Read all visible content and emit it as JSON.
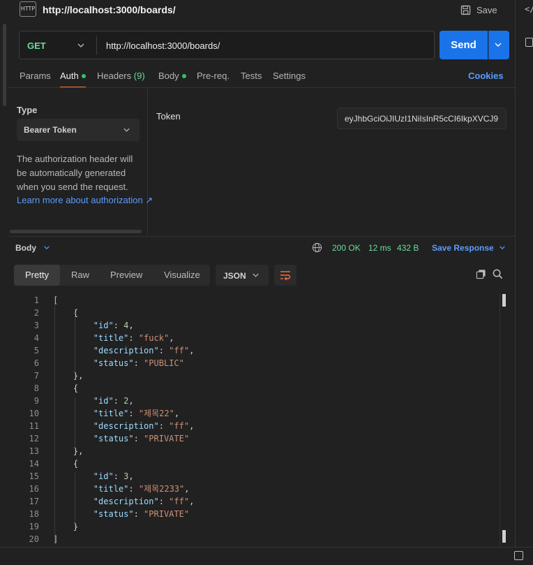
{
  "request": {
    "title": "http://localhost:3000/boards/",
    "save_label": "Save",
    "method": "GET",
    "url": "http://localhost:3000/boards/",
    "send_label": "Send"
  },
  "tabs": {
    "params": "Params",
    "auth": "Auth",
    "headers": "Headers",
    "headers_count": "(9)",
    "body": "Body",
    "prereq": "Pre-req.",
    "tests": "Tests",
    "settings": "Settings",
    "cookies": "Cookies"
  },
  "auth": {
    "type_label": "Type",
    "type_value": "Bearer Token",
    "description": "The authorization header will be automatically generated when you send the request.",
    "learn_more": "Learn more about authorization ↗",
    "token_label": "Token",
    "token_value": "eyJhbGciOiJIUzI1NiIsInR5cCI6IkpXVCJ9"
  },
  "response": {
    "body_label": "Body",
    "status": "200 OK",
    "time": "12 ms",
    "size": "432 B",
    "save_response": "Save Response",
    "view_tabs": [
      "Pretty",
      "Raw",
      "Preview",
      "Visualize"
    ],
    "format": "JSON",
    "lines": [
      [
        [
          "punc",
          "["
        ]
      ],
      [
        [
          "punc",
          "    {"
        ]
      ],
      [
        [
          "punc",
          "        "
        ],
        [
          "key",
          "\"id\""
        ],
        [
          "punc",
          ": "
        ],
        [
          "num",
          "4"
        ],
        [
          "punc",
          ","
        ]
      ],
      [
        [
          "punc",
          "        "
        ],
        [
          "key",
          "\"title\""
        ],
        [
          "punc",
          ": "
        ],
        [
          "str",
          "\"fuck\""
        ],
        [
          "punc",
          ","
        ]
      ],
      [
        [
          "punc",
          "        "
        ],
        [
          "key",
          "\"description\""
        ],
        [
          "punc",
          ": "
        ],
        [
          "str",
          "\"ff\""
        ],
        [
          "punc",
          ","
        ]
      ],
      [
        [
          "punc",
          "        "
        ],
        [
          "key",
          "\"status\""
        ],
        [
          "punc",
          ": "
        ],
        [
          "str",
          "\"PUBLIC\""
        ]
      ],
      [
        [
          "punc",
          "    },"
        ]
      ],
      [
        [
          "punc",
          "    {"
        ]
      ],
      [
        [
          "punc",
          "        "
        ],
        [
          "key",
          "\"id\""
        ],
        [
          "punc",
          ": "
        ],
        [
          "num",
          "2"
        ],
        [
          "punc",
          ","
        ]
      ],
      [
        [
          "punc",
          "        "
        ],
        [
          "key",
          "\"title\""
        ],
        [
          "punc",
          ": "
        ],
        [
          "str",
          "\"제목22\""
        ],
        [
          "punc",
          ","
        ]
      ],
      [
        [
          "punc",
          "        "
        ],
        [
          "key",
          "\"description\""
        ],
        [
          "punc",
          ": "
        ],
        [
          "str",
          "\"ff\""
        ],
        [
          "punc",
          ","
        ]
      ],
      [
        [
          "punc",
          "        "
        ],
        [
          "key",
          "\"status\""
        ],
        [
          "punc",
          ": "
        ],
        [
          "str",
          "\"PRIVATE\""
        ]
      ],
      [
        [
          "punc",
          "    },"
        ]
      ],
      [
        [
          "punc",
          "    {"
        ]
      ],
      [
        [
          "punc",
          "        "
        ],
        [
          "key",
          "\"id\""
        ],
        [
          "punc",
          ": "
        ],
        [
          "num",
          "3"
        ],
        [
          "punc",
          ","
        ]
      ],
      [
        [
          "punc",
          "        "
        ],
        [
          "key",
          "\"title\""
        ],
        [
          "punc",
          ": "
        ],
        [
          "str",
          "\"제목2233\""
        ],
        [
          "punc",
          ","
        ]
      ],
      [
        [
          "punc",
          "        "
        ],
        [
          "key",
          "\"description\""
        ],
        [
          "punc",
          ": "
        ],
        [
          "str",
          "\"ff\""
        ],
        [
          "punc",
          ","
        ]
      ],
      [
        [
          "punc",
          "        "
        ],
        [
          "key",
          "\"status\""
        ],
        [
          "punc",
          ": "
        ],
        [
          "str",
          "\"PRIVATE\""
        ]
      ],
      [
        [
          "punc",
          "    }"
        ]
      ],
      [
        [
          "punc",
          "]"
        ]
      ]
    ]
  },
  "colors": {
    "accent": "#ff6c37",
    "send": "#1a73e8",
    "link": "#5b9cff",
    "success": "#6bdd9a"
  }
}
